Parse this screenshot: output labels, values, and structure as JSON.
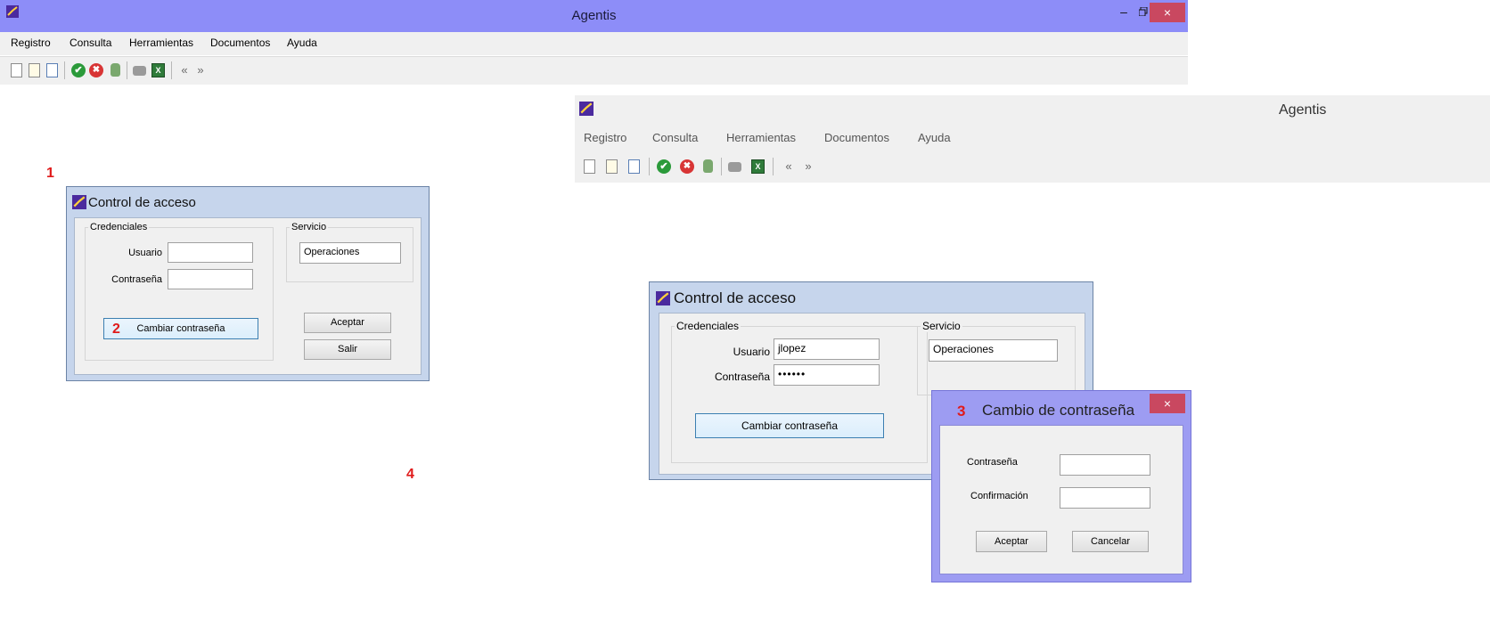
{
  "app_title": "Agentis",
  "menu": [
    "Registro",
    "Consulta",
    "Herramientas",
    "Documentos",
    "Ayuda"
  ],
  "window_controls": {
    "minimize": "–",
    "maximize": "🗗",
    "close": "×"
  },
  "toolbar_icons": [
    "new-document-icon",
    "open-document-icon",
    "edit-document-icon",
    "accept-icon",
    "cancel-icon",
    "database-icon",
    "print-icon",
    "excel-export-icon",
    "previous-icon",
    "next-icon"
  ],
  "toolbar_glyphs": {
    "ok": "✔",
    "no": "✖",
    "xls": "X",
    "prev": "«",
    "next": "»"
  },
  "step_labels": [
    "1",
    "2",
    "3",
    "4"
  ],
  "login_dialog": {
    "title": "Control de acceso",
    "credentials_group": "Credenciales",
    "service_group": "Servicio",
    "user_label": "Usuario",
    "password_label": "Contraseña",
    "service_value": "Operaciones",
    "change_password_button": "Cambiar contraseña",
    "accept_button": "Aceptar",
    "exit_button": "Salir"
  },
  "login_dialog_filled": {
    "title": "Control de acceso",
    "credentials_group": "Credenciales",
    "service_group": "Servicio",
    "user_label": "Usuario",
    "user_value": "jlopez",
    "password_label": "Contraseña",
    "password_value": "••••••",
    "service_value": "Operaciones",
    "change_password_button": "Cambiar contraseña"
  },
  "change_password_dialog": {
    "title": "Cambio de contraseña",
    "close": "×",
    "password_label": "Contraseña",
    "confirm_label": "Confirmación",
    "accept_button": "Aceptar",
    "cancel_button": "Cancelar"
  },
  "colors": {
    "titlebar_active": "#8d8df8",
    "close_button": "#c94860",
    "dialog_frame": "#c6d5ec",
    "step_label": "#e01b1b"
  }
}
